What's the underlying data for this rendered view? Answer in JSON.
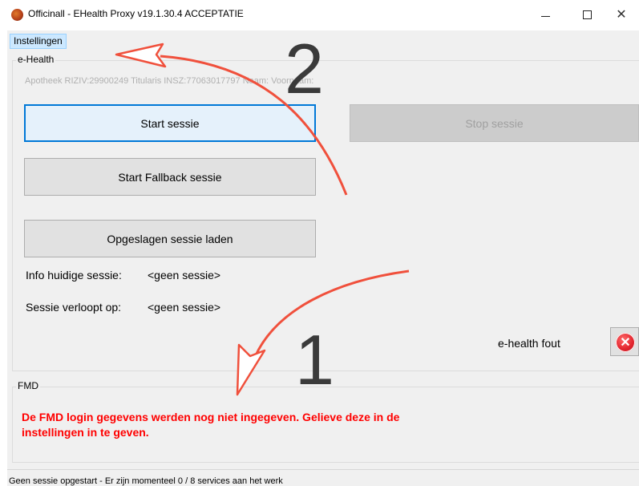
{
  "window": {
    "title": "Officinall - EHealth Proxy  v19.1.30.4  ACCEPTATIE",
    "controls": {
      "minimize_icon": "minimize-icon",
      "maximize_icon": "maximize-icon",
      "close_glyph": "✕"
    }
  },
  "menu": {
    "settings_label": "Instellingen"
  },
  "ehealth": {
    "group_label": "e-Health",
    "info_line": "Apotheek RIZIV:29900249   Titularis  INSZ:77063017797   Naam:   Voornaam:",
    "start_session": "Start sessie",
    "stop_session": "Stop sessie",
    "start_fallback": "Start Fallback sessie",
    "load_saved": "Opgeslagen sessie laden",
    "info_label": "Info huidige sessie:",
    "info_value": "<geen sessie>",
    "expiry_label": "Sessie verloopt op:",
    "expiry_value": "<geen sessie>",
    "error_label": "e-health fout",
    "error_icon": "error-icon",
    "error_glyph": "✕"
  },
  "fmd": {
    "group_label": "FMD",
    "message": "De FMD login gegevens werden nog niet ingegeven. Gelieve deze in de instellingen in te geven."
  },
  "status": {
    "text": "Geen sessie opgestart - Er zijn momenteel 0 / 8 services aan het werk"
  },
  "annotations": {
    "marker_1": "1",
    "marker_2": "2",
    "arrow_color": "#f0503c"
  }
}
